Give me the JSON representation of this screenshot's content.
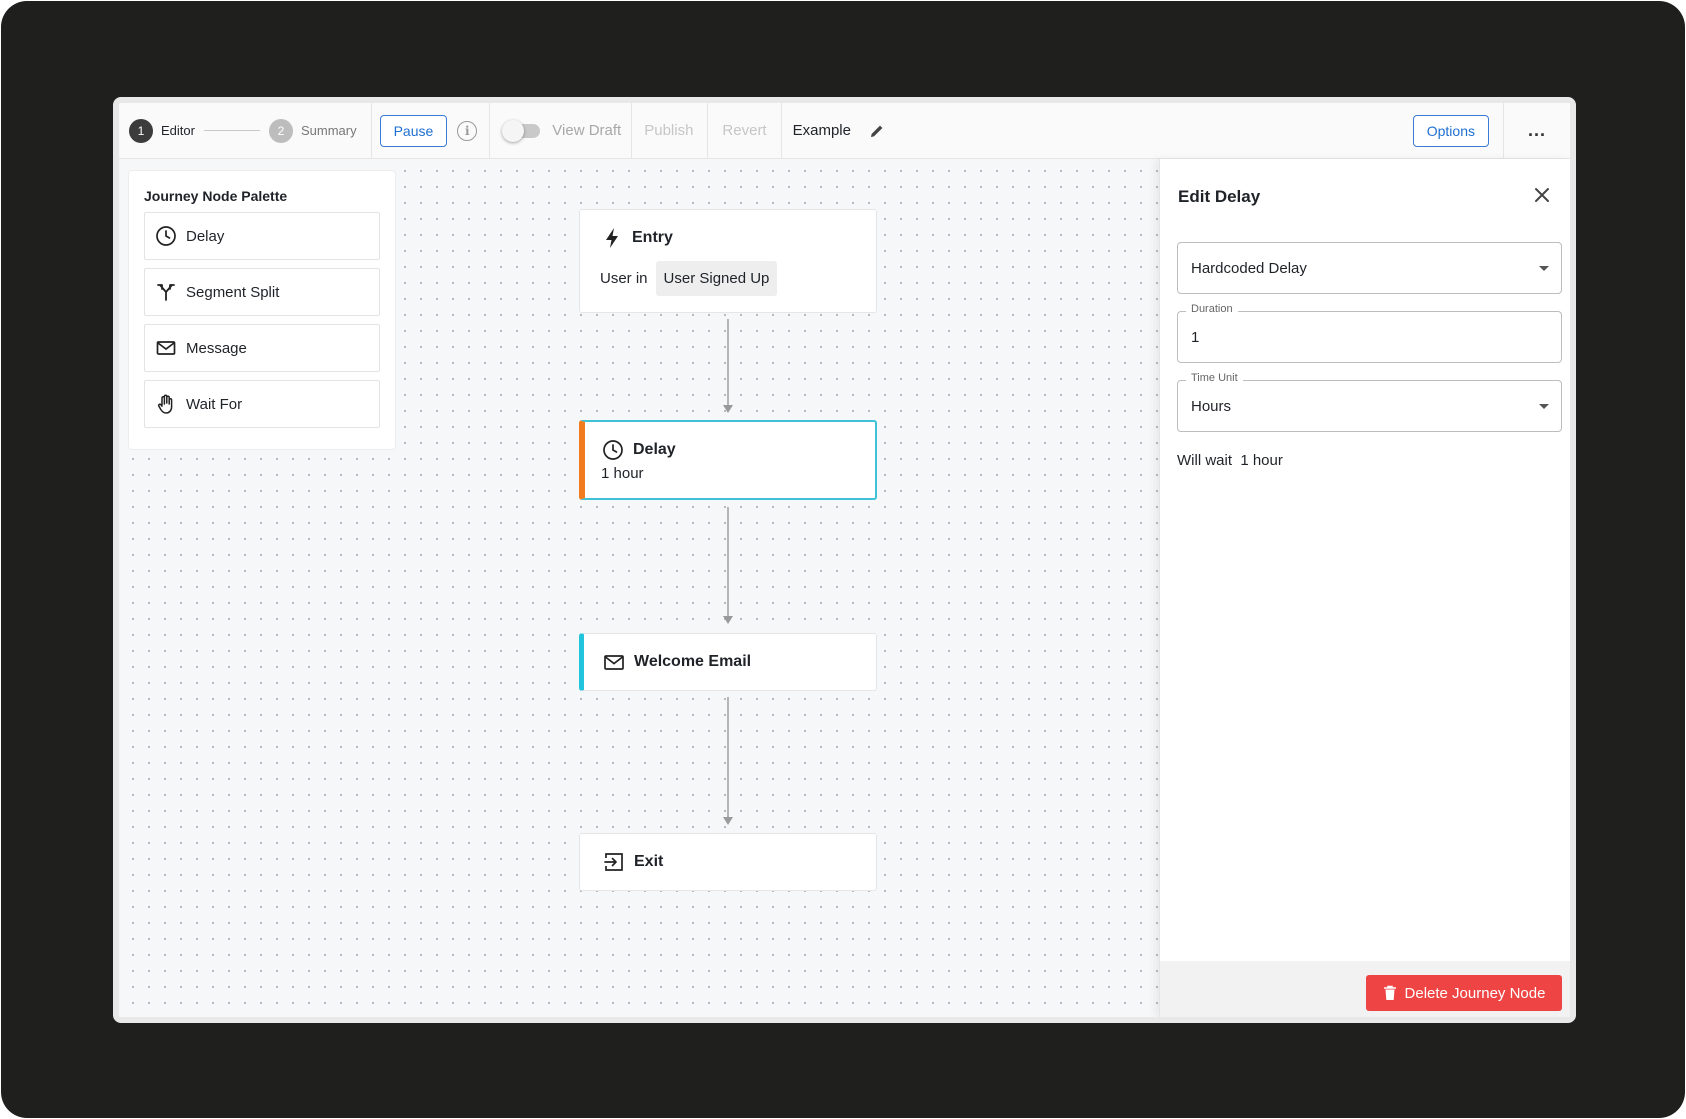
{
  "toolbar": {
    "steps": [
      {
        "number": "1",
        "label": "Editor",
        "state": "active"
      },
      {
        "number": "2",
        "label": "Summary",
        "state": "inactive"
      }
    ],
    "pause_label": "Pause",
    "info_icon": "i",
    "view_draft_label": "View Draft",
    "view_draft_on": false,
    "publish_label": "Publish",
    "revert_label": "Revert",
    "journey_name": "Example",
    "options_label": "Options",
    "more_label": "..."
  },
  "palette": {
    "title": "Journey Node Palette",
    "items": [
      {
        "label": "Delay",
        "icon": "clock-icon"
      },
      {
        "label": "Segment Split",
        "icon": "split-icon"
      },
      {
        "label": "Message",
        "icon": "envelope-icon"
      },
      {
        "label": "Wait For",
        "icon": "hand-icon"
      }
    ]
  },
  "nodes": {
    "entry": {
      "title": "Entry",
      "prefix": "User in",
      "segment": "User Signed Up",
      "icon": "lightning-icon"
    },
    "delay": {
      "title": "Delay",
      "subtitle": "1 hour",
      "icon": "clock-icon",
      "accent_color": "#f07c1e",
      "selected_border": "#3fc2d8"
    },
    "email": {
      "title": "Welcome Email",
      "icon": "envelope-icon",
      "accent_color": "#22c3dd"
    },
    "exit": {
      "title": "Exit",
      "icon": "exit-icon"
    }
  },
  "panel": {
    "title": "Edit Delay",
    "delay_type": "Hardcoded Delay",
    "duration_label": "Duration",
    "duration_value": "1",
    "time_unit_label": "Time Unit",
    "time_unit_value": "Hours",
    "wait_text": "Will wait  1 hour",
    "delete_label": "Delete Journey Node",
    "delete_color": "#ef4444"
  }
}
